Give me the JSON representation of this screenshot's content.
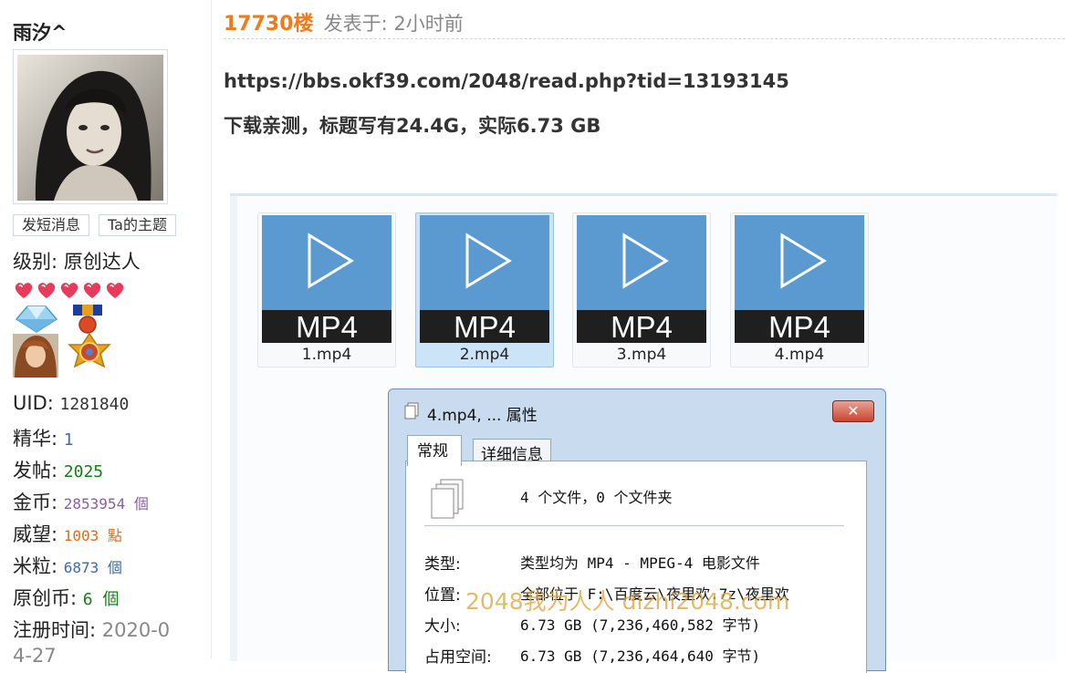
{
  "user": {
    "name": "雨汐^",
    "buttons": {
      "message": "发短消息",
      "topics": "Ta的主题"
    },
    "level_label": "级别:",
    "level": "原创达人",
    "stats": [
      {
        "label": "UID:",
        "value": "1281840"
      },
      {
        "label": "精华:",
        "value": "1"
      },
      {
        "label": "发帖:",
        "value": "2025"
      },
      {
        "label": "金币:",
        "value": "2853954 個"
      },
      {
        "label": "威望:",
        "value": "1003 點"
      },
      {
        "label": "米粒:",
        "value": "6873 個"
      },
      {
        "label": "原创币:",
        "value": "6 個"
      }
    ],
    "register_label": "注册时间:",
    "register_value_line1": "2020-0",
    "register_value_line2": "4-27",
    "colors": {
      "heart": "#e83b5c",
      "floor": "#f07b1a"
    }
  },
  "post": {
    "floor": "17730楼",
    "posted": "发表于: 2小时前",
    "url": "https://bbs.okf39.com/2048/read.php?tid=13193145",
    "text": "下载亲测，标题写有24.4G，实际6.73 GB"
  },
  "screenshot": {
    "icon_label": "MP4",
    "files": [
      {
        "name": "1.mp4",
        "selected": false
      },
      {
        "name": "2.mp4",
        "selected": true
      },
      {
        "name": "3.mp4",
        "selected": false
      },
      {
        "name": "4.mp4",
        "selected": false
      }
    ],
    "dialog": {
      "title": "4.mp4, ... 属性",
      "close": "✕",
      "tabs": [
        "常规",
        "详细信息"
      ],
      "summary": "4 个文件，0 个文件夹",
      "properties": [
        {
          "label": "类型:",
          "value": "类型均为 MP4 - MPEG-4 电影文件"
        },
        {
          "label": "位置:",
          "value": "全部位于 F:\\百度云\\夜里欢.7z\\夜里欢"
        },
        {
          "label": "大小:",
          "value": "6.73 GB (7,236,460,582 字节)"
        },
        {
          "label": "占用空间:",
          "value": "6.73 GB (7,236,464,640 字节)"
        }
      ]
    },
    "watermark": "2048我为人人 dizhi2048.com"
  }
}
